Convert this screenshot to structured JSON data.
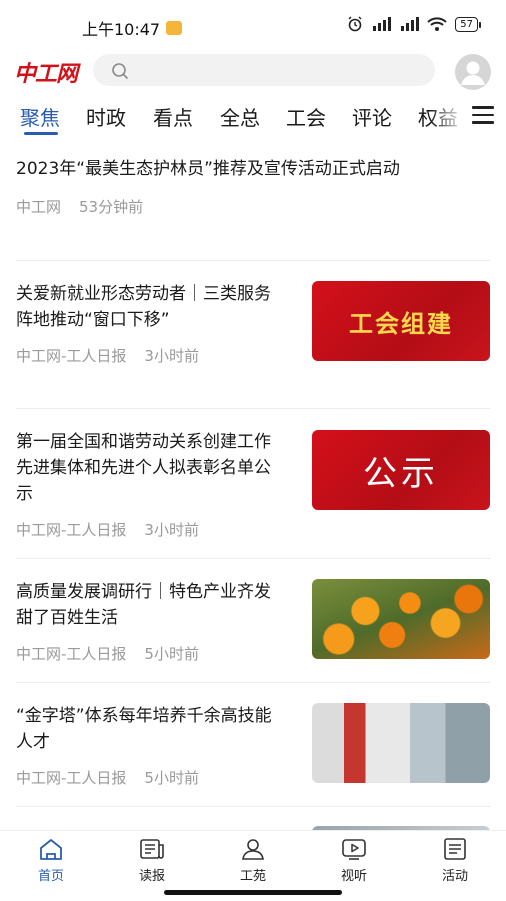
{
  "status_bar": {
    "time": "上午10:47",
    "battery": "57"
  },
  "header": {
    "logo": "中工网",
    "search_placeholder": ""
  },
  "tabs": [
    {
      "label": "聚焦",
      "active": true
    },
    {
      "label": "时政"
    },
    {
      "label": "看点"
    },
    {
      "label": "全总"
    },
    {
      "label": "工会"
    },
    {
      "label": "评论"
    },
    {
      "label": "权益"
    }
  ],
  "articles": [
    {
      "title": "2023年“最美生态护林员”推荐及宣传活动正式启动",
      "source": "中工网",
      "time": "53分钟前"
    },
    {
      "title": "关爱新就业形态劳动者｜三类服务阵地推动“窗口下移”",
      "source": "中工网-工人日报",
      "time": "3小时前",
      "thumb_text": "工会组建"
    },
    {
      "title": "第一届全国和谐劳动关系创建工作先进集体和先进个人拟表彰名单公示",
      "source": "中工网-工人日报",
      "time": "3小时前",
      "thumb_text": "公示"
    },
    {
      "title": "高质量发展调研行｜特色产业齐发 甜了百姓生活",
      "source": "中工网-工人日报",
      "time": "5小时前"
    },
    {
      "title": "“金字塔”体系每年培养千余高技能人才",
      "source": "中工网-工人日报",
      "time": "5小时前"
    }
  ],
  "bottom_nav": [
    {
      "label": "首页",
      "icon": "home-icon",
      "active": true
    },
    {
      "label": "读报",
      "icon": "newspaper-icon"
    },
    {
      "label": "工苑",
      "icon": "person-icon"
    },
    {
      "label": "视听",
      "icon": "play-icon"
    },
    {
      "label": "活动",
      "icon": "list-icon"
    }
  ],
  "colors": {
    "accent": "#2a5db0",
    "brand": "#d0121b"
  }
}
